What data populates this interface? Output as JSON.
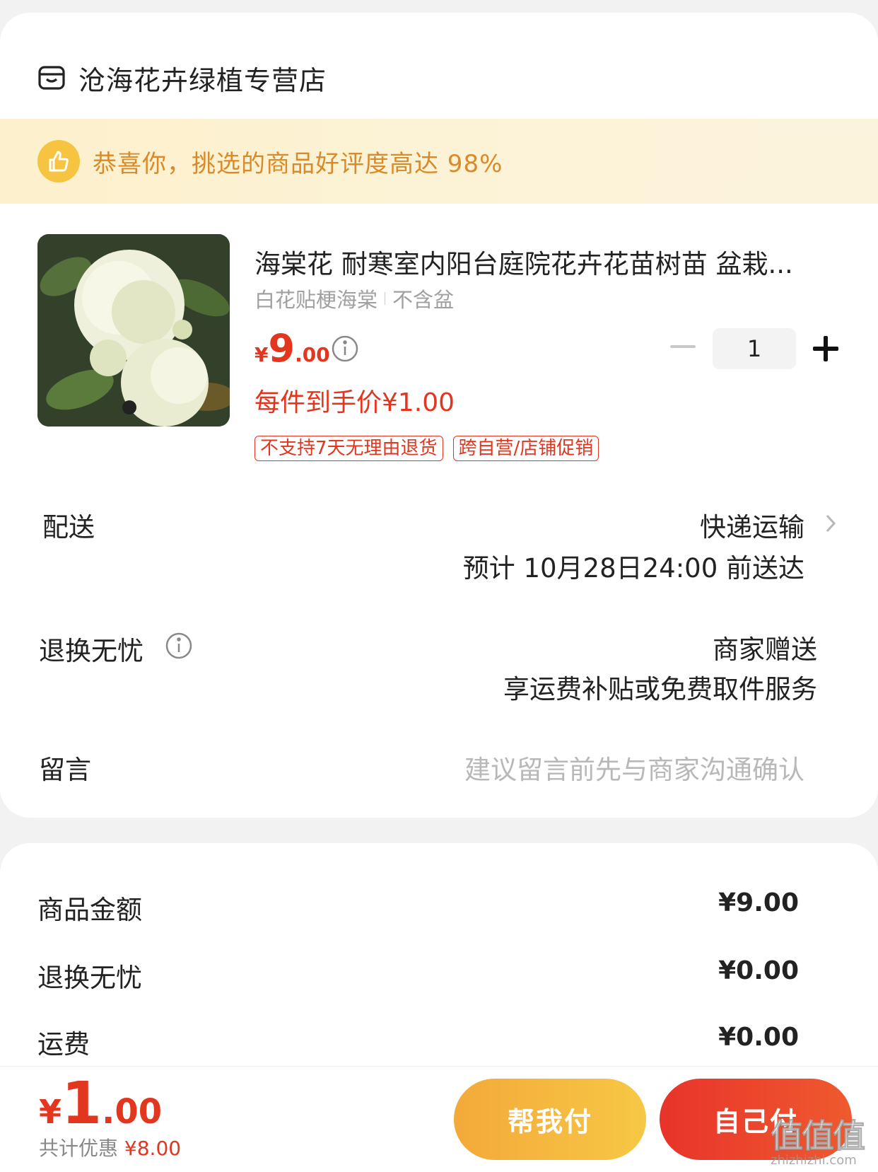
{
  "store": {
    "name": "沧海花卉绿植专营店",
    "icon": "store-icon"
  },
  "banner": {
    "text": "恭喜你，挑选的商品好评度高达 98%",
    "icon": "thumbs-up-icon"
  },
  "product": {
    "title": "海棠花 耐寒室内阳台庭院花卉花苗树苗 盆栽...",
    "spec": [
      "白花贴梗海棠",
      "不含盆"
    ],
    "price": {
      "yen": "¥",
      "int": "9",
      "dec": ".00"
    },
    "quantity": "1",
    "unit_price": "每件到手价¥1.00",
    "tags": [
      "不支持7天无理由退货",
      "跨自营/店铺促销"
    ]
  },
  "delivery": {
    "label": "配送",
    "method": "快递运输",
    "eta": "预计 10月28日24:00 前送达"
  },
  "returns": {
    "label": "退换无忧",
    "line1": "商家赠送",
    "line2": "享运费补贴或免费取件服务"
  },
  "message": {
    "label": "留言",
    "placeholder": "建议留言前先与商家沟通确认"
  },
  "summary": [
    {
      "label": "商品金额",
      "value": "¥9.00"
    },
    {
      "label": "退换无忧",
      "value": "¥0.00"
    },
    {
      "label": "运费",
      "value": "¥0.00"
    }
  ],
  "footer": {
    "total": {
      "yen": "¥",
      "int": "1",
      "dec": ".00"
    },
    "discount_label": "共计优惠",
    "discount_value": "¥8.00",
    "help_pay": "帮我付",
    "self_pay": "自己付"
  },
  "watermark": {
    "logo": "值值值",
    "text": "zhizhizhi.com"
  },
  "colors": {
    "accent_red": "#e2361f",
    "banner_bg": "#fdf0cc",
    "banner_text": "#d98a2a",
    "help_btn": "#f6b93f",
    "self_btn": "#e8332b"
  }
}
